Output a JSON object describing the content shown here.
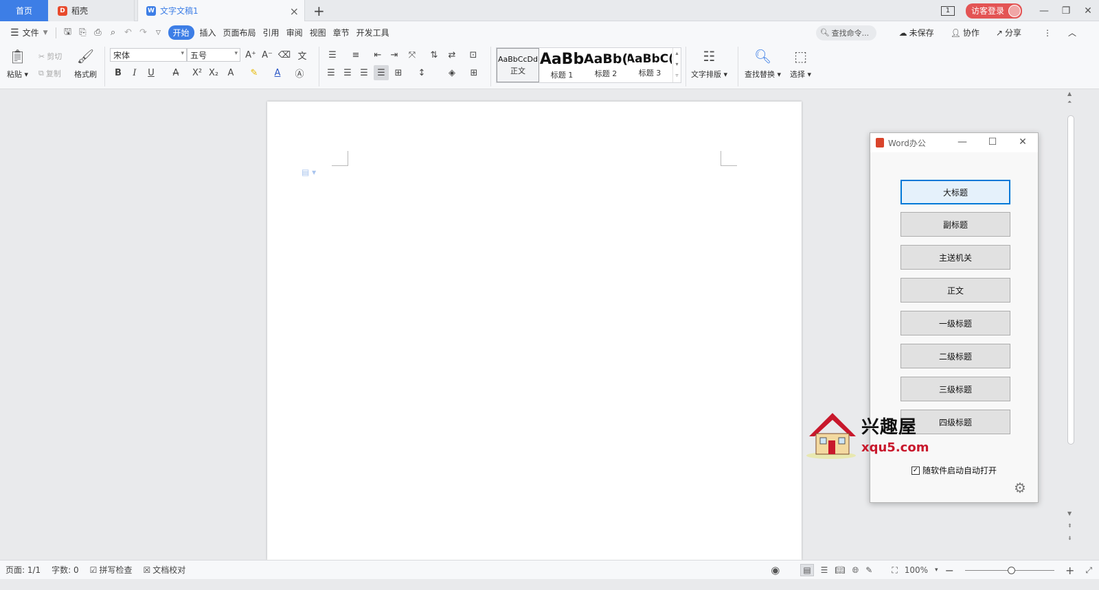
{
  "tabbar": {
    "home_label": "首页",
    "tabs": [
      {
        "label": "稻壳",
        "icon": "daoke-logo-icon"
      },
      {
        "label": "文字文稿1",
        "icon": "wps-writer-icon"
      }
    ],
    "page_count_badge": "1",
    "login_label": "访客登录"
  },
  "menu": {
    "file_label": "文件",
    "tabs": [
      "开始",
      "插入",
      "页面布局",
      "引用",
      "审阅",
      "视图",
      "章节",
      "开发工具"
    ],
    "active_tab": "开始",
    "search_placeholder": "查找命令...",
    "unsaved_label": "未保存",
    "collab_label": "协作",
    "share_label": "分享"
  },
  "ribbon": {
    "paste_label": "粘贴",
    "cut_label": "剪切",
    "copy_label": "复制",
    "format_painter_label": "格式刷",
    "font_name": "宋体",
    "font_size": "五号",
    "styles": [
      {
        "preview": "AaBbCcDd",
        "label": "正文"
      },
      {
        "preview": "AaBb",
        "label": "标题 1"
      },
      {
        "preview": "AaBb(",
        "label": "标题 2"
      },
      {
        "preview": "AaBbC(",
        "label": "标题 3"
      }
    ],
    "text_layout_label": "文字排版",
    "find_replace_label": "查找替换",
    "select_label": "选择"
  },
  "dialog": {
    "title": "Word办公",
    "buttons": [
      "大标题",
      "副标题",
      "主送机关",
      "正文",
      "一级标题",
      "二级标题",
      "三级标题",
      "四级标题"
    ],
    "autostart_label": "随软件启动自动打开",
    "autostart_checked": true
  },
  "watermark": {
    "title": "兴趣屋",
    "url": "xqu5.com"
  },
  "status": {
    "page": "页面: 1/1",
    "words": "字数: 0",
    "spell_check": "拼写检查",
    "doc_proof": "文档校对",
    "zoom": "100%"
  },
  "colors": {
    "accent": "#3d7ee6",
    "login": "#e35454",
    "watermark_red": "#c8182c"
  }
}
